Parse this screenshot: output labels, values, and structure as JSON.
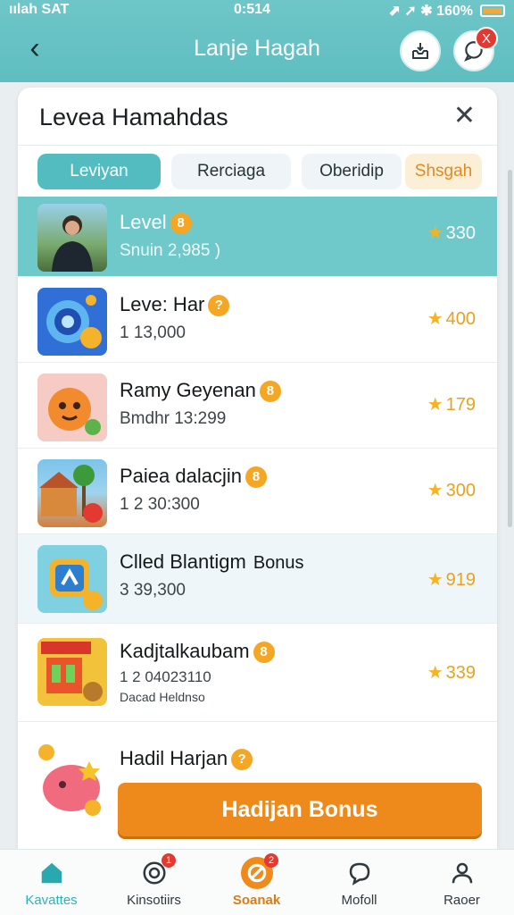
{
  "status_bar": {
    "left": "ıılah SAT ",
    "time": "0:514",
    "right": "⬈ ➚ ✱ 160%"
  },
  "header": {
    "title": "Lanje Hagah"
  },
  "sheet": {
    "title": "Levea Hamahdas",
    "tabs": [
      {
        "label": "Leviyan",
        "active": true
      },
      {
        "label": "Rerciaga",
        "active": false
      },
      {
        "label": "Oberidip",
        "active": false
      },
      {
        "label": "Shsgah",
        "active": false
      }
    ],
    "rows": [
      {
        "title": "Level",
        "coin": "8",
        "sub": "Snuin 2,985   )",
        "stars": "330",
        "highlight": true
      },
      {
        "title": "Leve: Har",
        "coin": "?",
        "sub": "1      13,000",
        "stars": "400",
        "highlight": false
      },
      {
        "title": "Ramy Geyenan",
        "coin": "8",
        "sub": "Bmdhr 13:299",
        "stars": "179",
        "highlight": false
      },
      {
        "title": "Paiea dalacjin",
        "coin": "8",
        "sub": "1  2  30:300",
        "stars": "300",
        "highlight": false
      },
      {
        "title": "Clled Blantigm",
        "bonus": "Bonus",
        "sub": "3      39,300",
        "stars": "919",
        "highlight": false
      },
      {
        "title": "Kadjtalkaubam",
        "coin": "8",
        "sub": "1  2   04023110",
        "sub2": "Dacad Heldnso",
        "stars": "339",
        "highlight": false
      }
    ],
    "bonus_row": {
      "title": "Hadil Harjan",
      "coin": "?",
      "button_label": "Hadijan Bonus"
    }
  },
  "bottom_nav": [
    {
      "label": "Kavattes",
      "icon": "home-icon",
      "active": true
    },
    {
      "label": "Kinsotiirs",
      "icon": "target-icon",
      "badge": "1"
    },
    {
      "label": "Soanak",
      "icon": "ban-icon",
      "badge": "2",
      "hot": true
    },
    {
      "label": "Mofoll",
      "icon": "chat-icon"
    },
    {
      "label": "Raoer",
      "icon": "user-icon"
    }
  ]
}
